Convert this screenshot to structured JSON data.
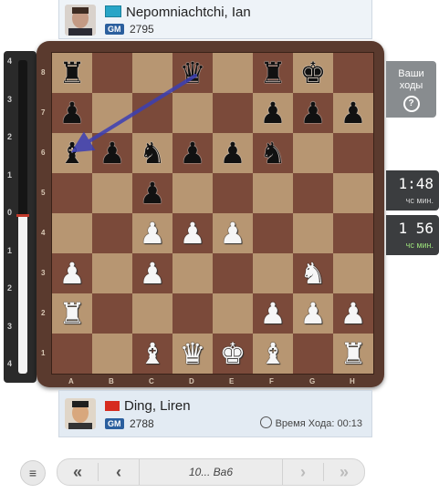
{
  "top_player": {
    "name": "Nepomniachtchi, Ian",
    "title": "GM",
    "rating": "2795",
    "flag": "kazakhstan-flag"
  },
  "bottom_player": {
    "name": "Ding, Liren",
    "title": "GM",
    "rating": "2788",
    "flag": "china-flag",
    "move_time": "Время Хода: 00:13"
  },
  "your_moves": {
    "line1": "Ваши",
    "line2": "ходы",
    "icon": "?"
  },
  "clocks": {
    "top": {
      "time": "1:48",
      "units": "чс  мин."
    },
    "bottom": {
      "time": "1 56",
      "units": "чс  мин."
    }
  },
  "eval_bar": {
    "ticks": [
      "4",
      "3",
      "2",
      "1",
      "0",
      "1",
      "2",
      "3",
      "4"
    ],
    "white_fraction": 0.5
  },
  "board": {
    "ranks": [
      "8",
      "7",
      "6",
      "5",
      "4",
      "3",
      "2",
      "1"
    ],
    "files": [
      "A",
      "B",
      "C",
      "D",
      "E",
      "F",
      "G",
      "H"
    ],
    "position": [
      [
        "r",
        "",
        "",
        "q",
        "",
        "r",
        "k",
        ""
      ],
      [
        "p",
        "",
        "",
        "",
        "",
        "p",
        "p",
        "p"
      ],
      [
        "b",
        "p",
        "n",
        "p",
        "p",
        "n",
        "",
        ""
      ],
      [
        "",
        "",
        "p",
        "",
        "",
        "",
        "",
        ""
      ],
      [
        "",
        "",
        "P",
        "P",
        "P",
        "",
        "",
        ""
      ],
      [
        "P",
        "",
        "P",
        "",
        "",
        "",
        "N",
        ""
      ],
      [
        "R",
        "",
        "",
        "",
        "",
        "P",
        "P",
        "P"
      ],
      [
        "",
        "",
        "B",
        "Q",
        "K",
        "B",
        "",
        "R"
      ]
    ],
    "last_move_arrow": {
      "from": "d8",
      "to": "a6",
      "color": "#3b3fb5"
    }
  },
  "nav": {
    "move_label": "10... Ва6",
    "first": "«",
    "prev": "‹",
    "next": "›",
    "last": "»",
    "menu": "≡"
  }
}
